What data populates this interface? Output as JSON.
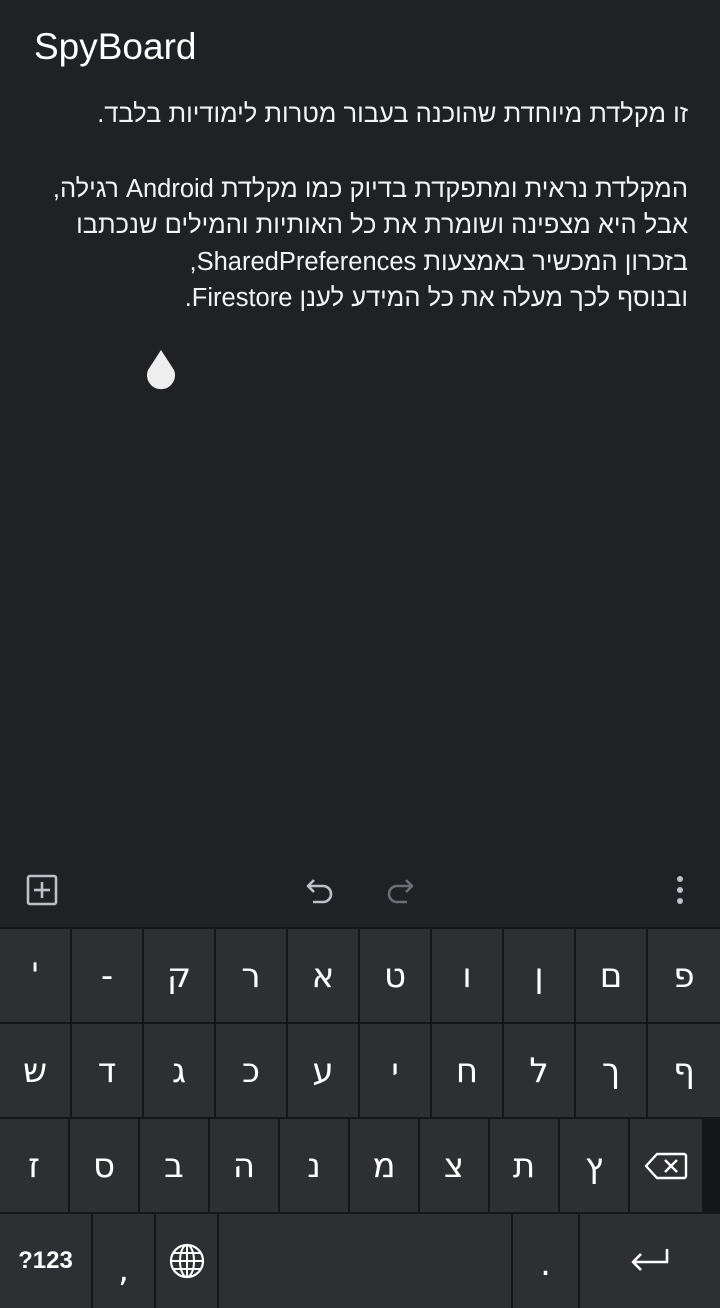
{
  "app": {
    "title": "SpyBoard"
  },
  "content": {
    "line1": "זו מקלדת מיוחדת שהוכנה בעבור מטרות לימודיות בלבד.",
    "line2": "המקלדת נראית ומתפקדת בדיוק כמו מקלדת Android רגילה,",
    "line3": "אבל היא מצפינה ושומרת את כל האותיות והמילים שנכתבו בזכרון המכשיר באמצעות SharedPreferences,",
    "line4": "ובנוסף לכך מעלה את כל המידע לענן Firestore."
  },
  "toolbar": {
    "icons": [
      "add-box-icon",
      "undo-icon",
      "redo-icon",
      "more-vert-icon"
    ],
    "redo_enabled": false
  },
  "keyboard": {
    "row1": [
      "פ",
      "ם",
      "ן",
      "ו",
      "ט",
      "א",
      "ר",
      "ק",
      "-",
      "'"
    ],
    "row2": [
      "ף",
      "ך",
      "ל",
      "ח",
      "י",
      "ע",
      "כ",
      "ג",
      "ד",
      "ש"
    ],
    "row3": [
      "ץ",
      "ת",
      "צ",
      "מ",
      "נ",
      "ה",
      "ב",
      "ס",
      "ז"
    ],
    "row4": {
      "symbols_label": "?123",
      "comma_label": ",",
      "period_label": "."
    },
    "colors": {
      "key_bg": "#2e2f32",
      "keyboard_bg": "#151618",
      "text": "#ffffff"
    }
  }
}
